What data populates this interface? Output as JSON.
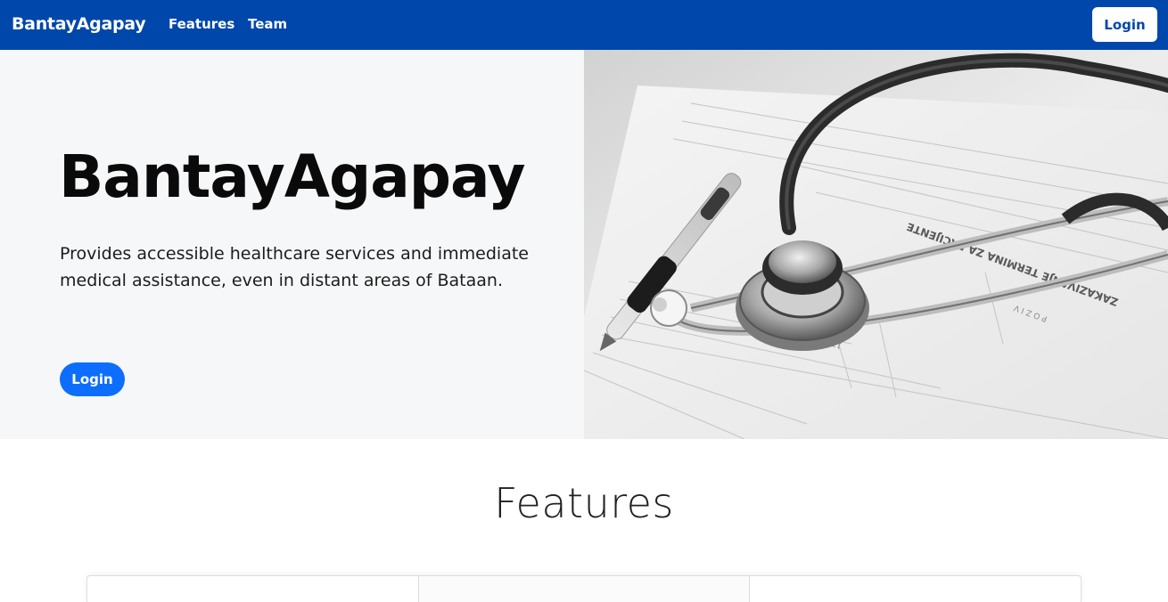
{
  "navbar": {
    "brand": "BantayAgapay",
    "links": [
      {
        "label": "Features"
      },
      {
        "label": "Team"
      }
    ],
    "login_label": "Login",
    "background_color": "#0047ab"
  },
  "hero": {
    "title": "BantayAgapay",
    "description": "Provides accessible healthcare services and immediate medical assistance, even in distant areas of Bataan.",
    "login_label": "Login",
    "button_color": "#0d6efd",
    "image_subject": "stethoscope-and-pen-on-medical-form"
  },
  "features": {
    "heading": "Features",
    "cards": [
      {},
      {},
      {}
    ]
  }
}
